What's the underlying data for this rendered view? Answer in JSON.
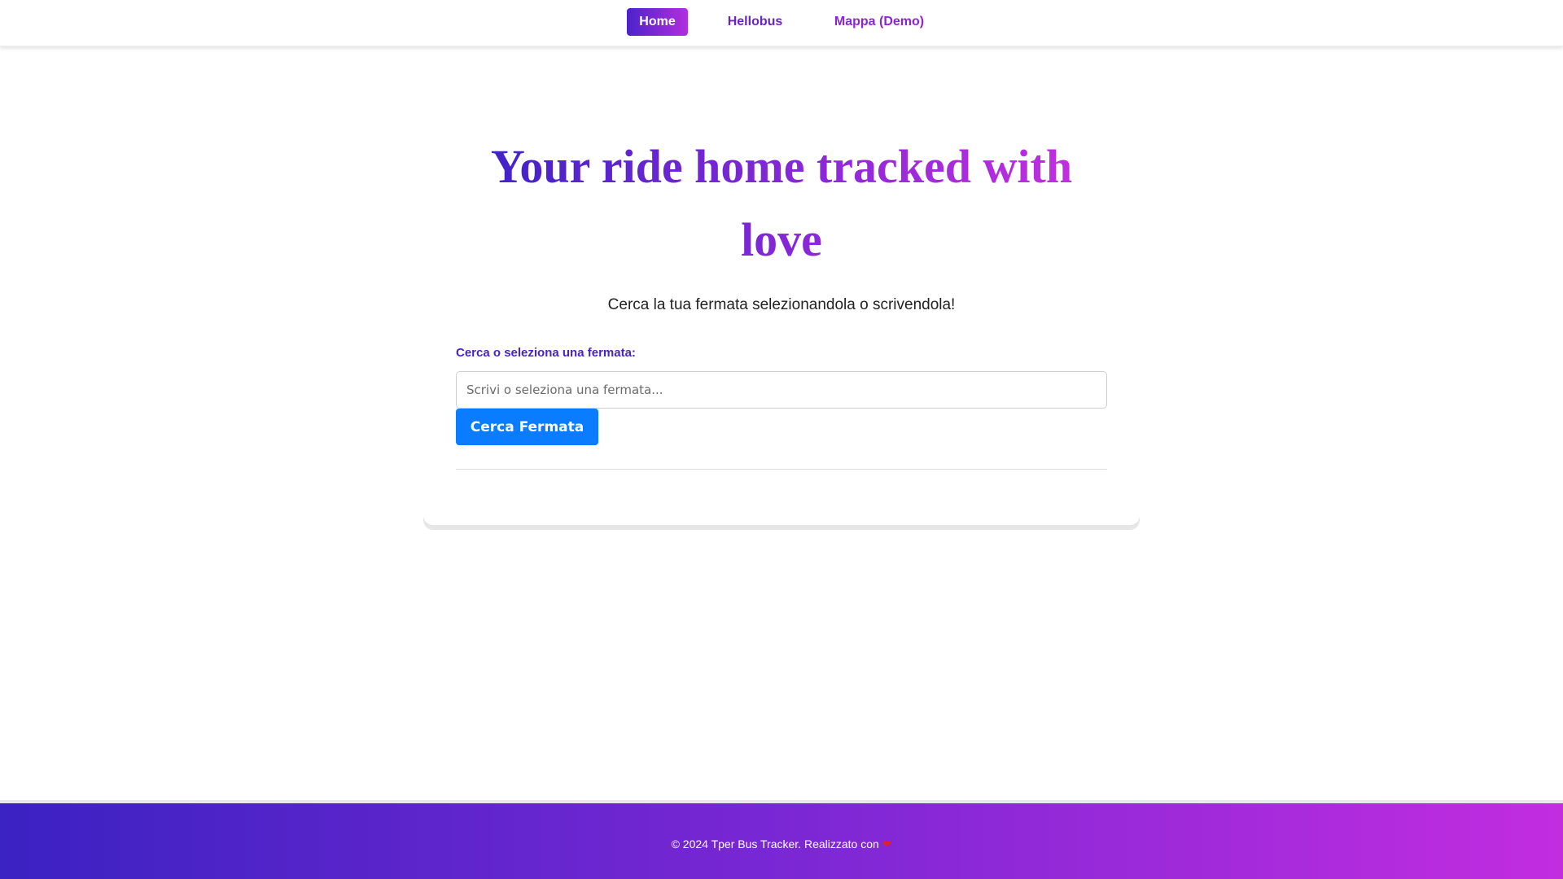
{
  "nav": {
    "items": [
      {
        "label": "Home"
      },
      {
        "label": "Hellobus"
      },
      {
        "label": "Mappa (Demo)"
      }
    ]
  },
  "hero": {
    "title": "Your ride home tracked with love",
    "subtitle": "Cerca la tua fermata selezionandola o scrivendola!"
  },
  "search": {
    "label": "Cerca o seleziona una fermata:",
    "placeholder": "Scrivi o seleziona una fermata...",
    "value": "",
    "button_label": "Cerca Fermata"
  },
  "footer": {
    "text": "© 2024 Tper Bus Tracker. Realizzato con",
    "icon": "heart-icon"
  },
  "colors": {
    "accent_start": "#3d22c8",
    "accent_end": "#c42fe0",
    "button": "#0a7cff",
    "heart": "#e0202a"
  }
}
